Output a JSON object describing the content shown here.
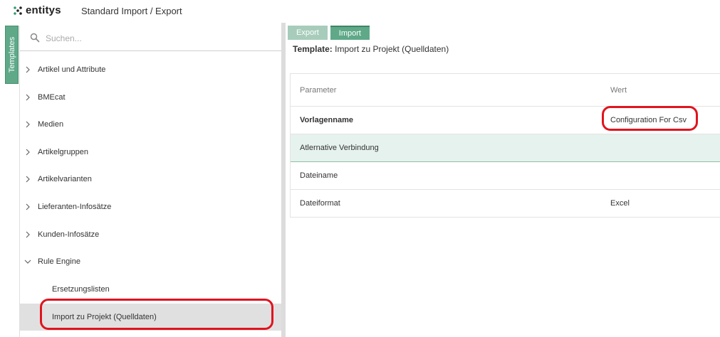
{
  "header": {
    "logo_text": "entitys",
    "title": "Standard Import / Export"
  },
  "sidebar": {
    "vertical_tab": "Templates",
    "search": {
      "placeholder": "Suchen...",
      "value": ""
    },
    "items": [
      {
        "label": "Artikel und Attribute",
        "expanded": false
      },
      {
        "label": "BMEcat",
        "expanded": false
      },
      {
        "label": "Medien",
        "expanded": false
      },
      {
        "label": "Artikelgruppen",
        "expanded": false
      },
      {
        "label": "Artikelvarianten",
        "expanded": false
      },
      {
        "label": "Lieferanten-Infosätze",
        "expanded": false
      },
      {
        "label": "Kunden-Infosätze",
        "expanded": false
      },
      {
        "label": "Rule Engine",
        "expanded": true
      }
    ],
    "children": [
      {
        "label": "Ersetzungslisten",
        "selected": false
      },
      {
        "label": "Import zu Projekt (Quelldaten)",
        "selected": true
      }
    ]
  },
  "main": {
    "tabs": [
      {
        "label": "Export",
        "active": false
      },
      {
        "label": "Import",
        "active": true
      }
    ],
    "template_label": "Template:",
    "template_name": "Import zu Projekt (Quelldaten)",
    "table": {
      "headers": {
        "param": "Parameter",
        "value": "Wert"
      },
      "rows": [
        {
          "param": "Vorlagenname",
          "value": "Configuration For Csv"
        },
        {
          "param": "Atlernative Verbindung",
          "value": ""
        },
        {
          "param": "Dateiname",
          "value": ""
        },
        {
          "param": "Dateiformat",
          "value": "Excel"
        }
      ]
    }
  },
  "colors": {
    "accent": "#5fa988",
    "accent_light": "#a7ccbb",
    "row_highlight": "#e6f2ed",
    "annotation": "#e0141e",
    "selected_bg": "#e0e0e0"
  }
}
